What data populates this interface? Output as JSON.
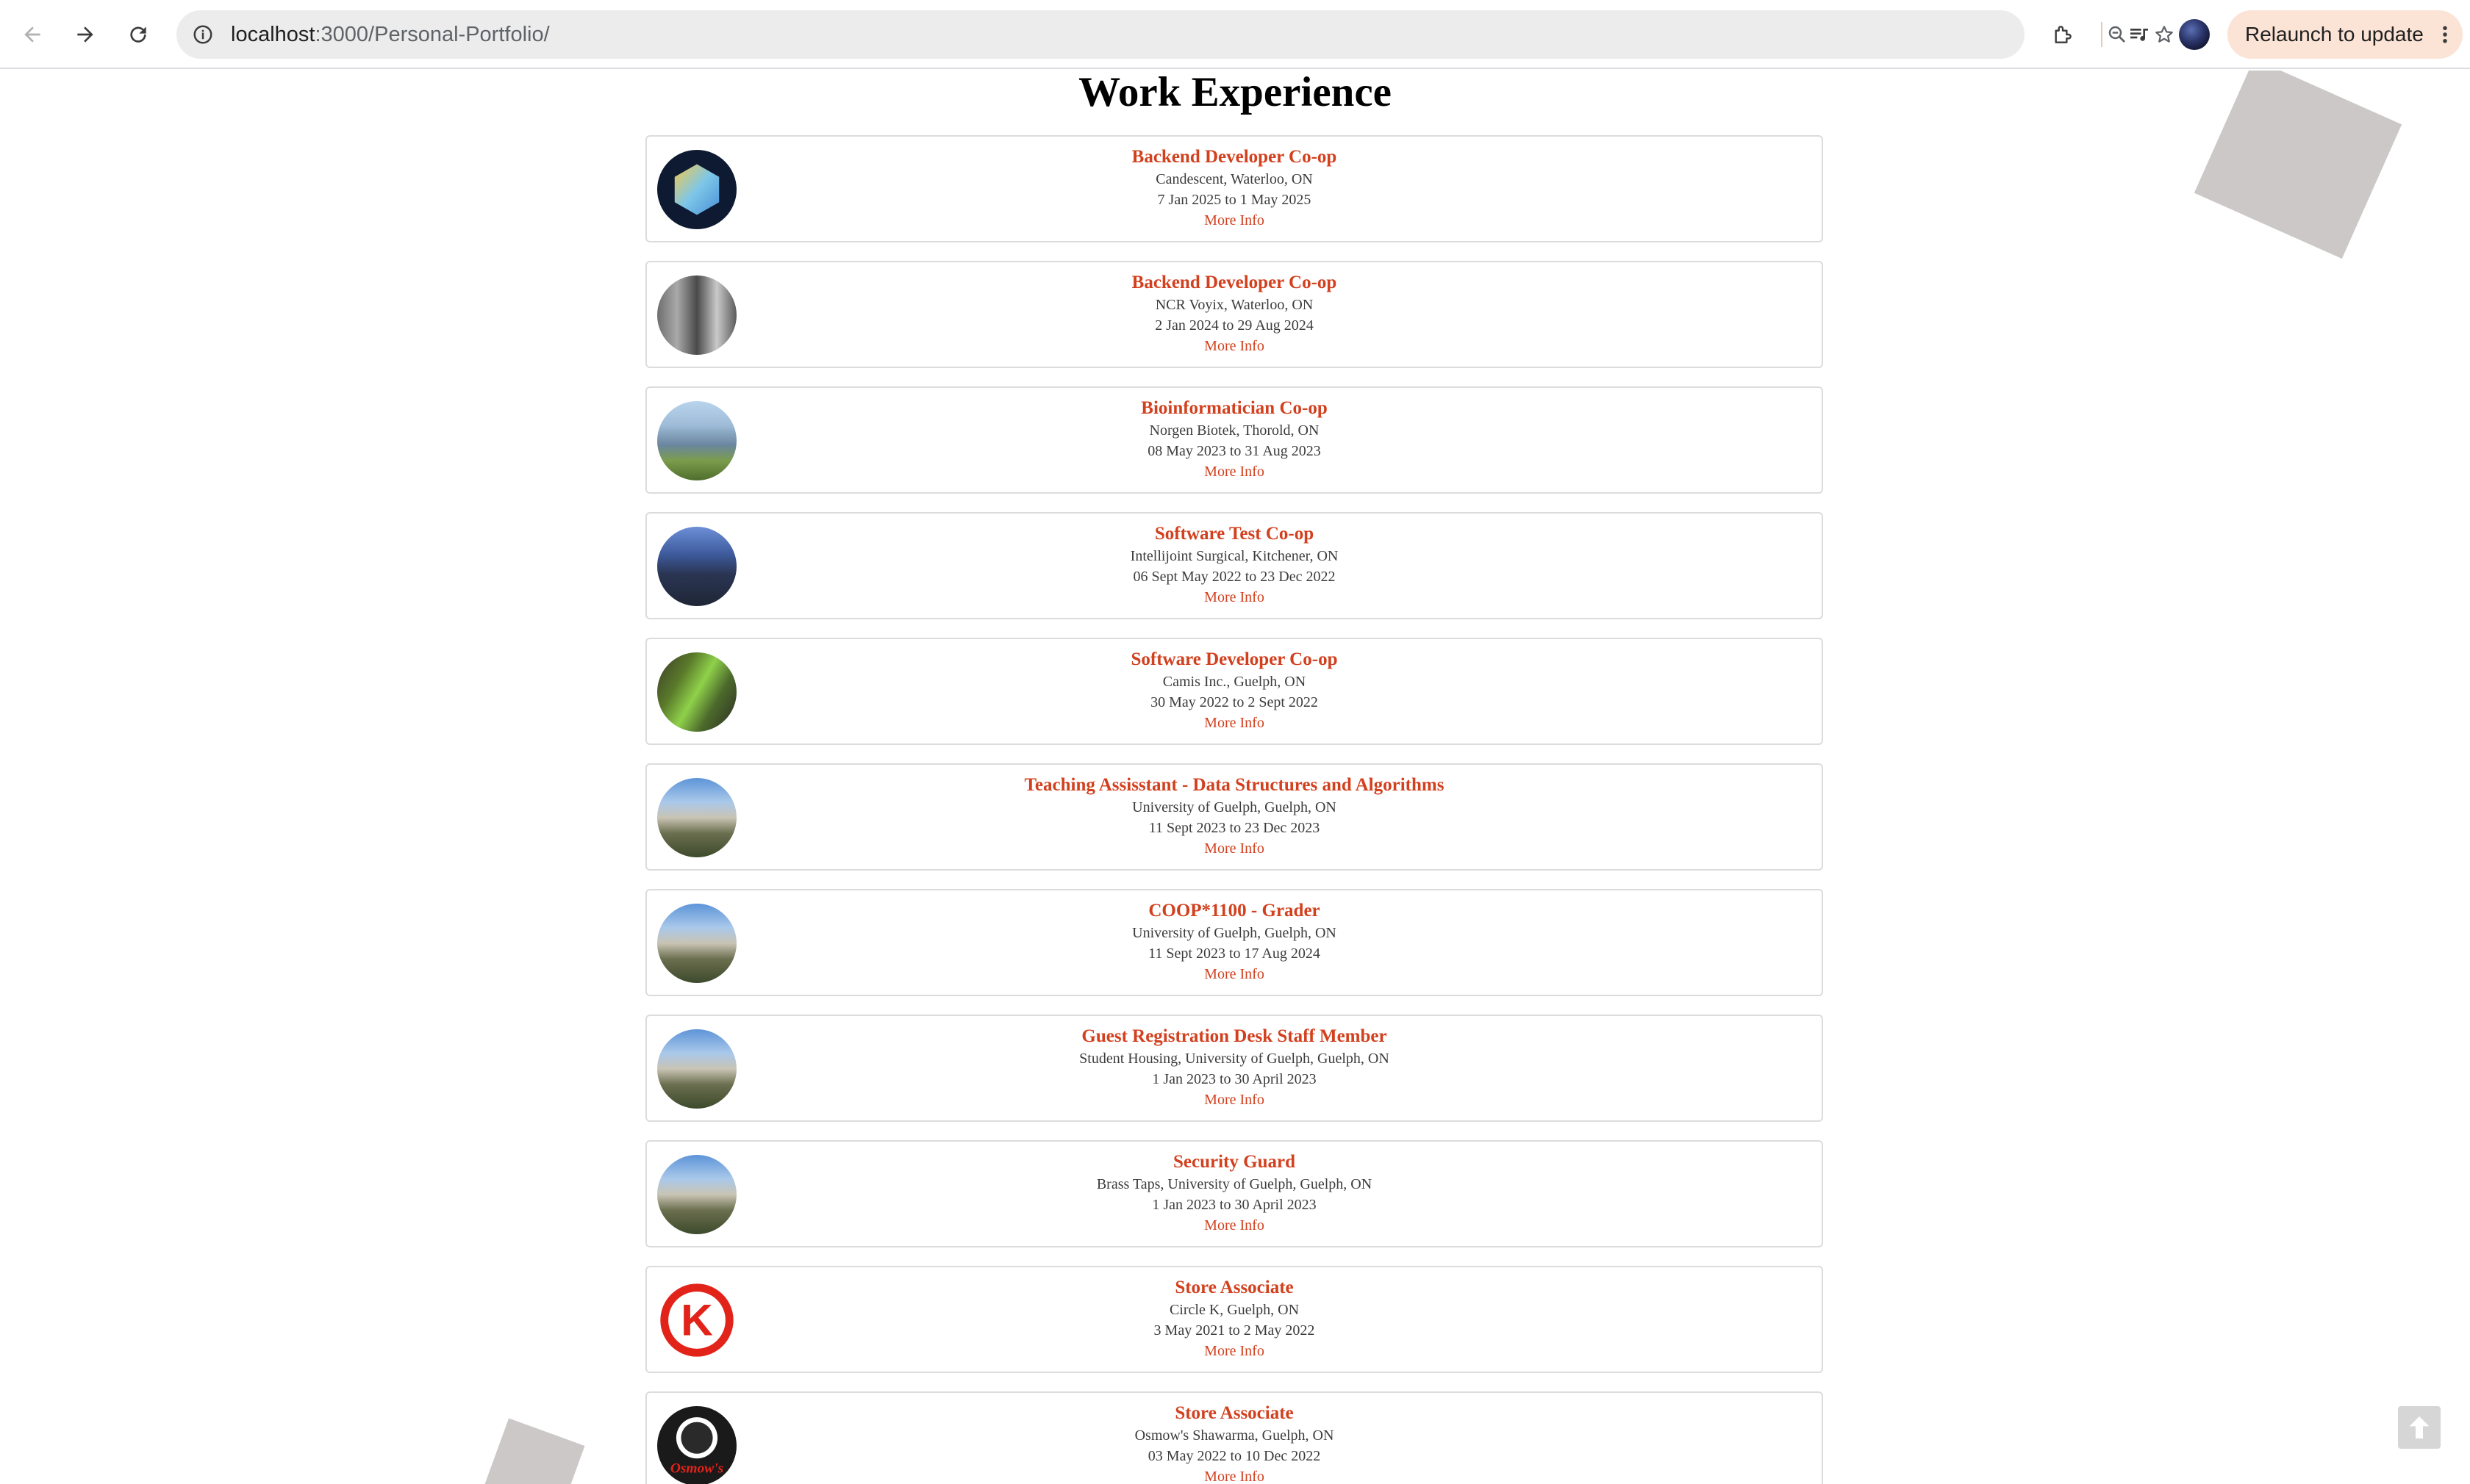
{
  "browser": {
    "url_host": "localhost",
    "url_rest": ":3000/Personal-Portfolio/",
    "relaunch_label": "Relaunch to update",
    "icons": [
      "back-icon",
      "forward-icon",
      "reload-icon",
      "info-icon",
      "zoom-icon",
      "star-icon",
      "extensions-icon",
      "media-controls-icon",
      "profile-avatar",
      "more-vert-icon"
    ]
  },
  "page": {
    "title": "Work Experience",
    "accent_color": "#d2401e",
    "jobs": [
      {
        "title": "Backend Developer Co-op",
        "company": "Candescent, Waterloo, ON",
        "dates": "7 Jan 2025 to 1 May 2025",
        "link": "More Info"
      },
      {
        "title": "Backend Developer Co-op",
        "company": "NCR Voyix, Waterloo, ON",
        "dates": "2 Jan 2024 to 29 Aug 2024",
        "link": "More Info"
      },
      {
        "title": "Bioinformatician Co-op",
        "company": "Norgen Biotek, Thorold, ON",
        "dates": "08 May 2023 to 31 Aug 2023",
        "link": "More Info"
      },
      {
        "title": "Software Test Co-op",
        "company": "Intellijoint Surgical, Kitchener, ON",
        "dates": "06 Sept May 2022 to 23 Dec 2022",
        "link": "More Info"
      },
      {
        "title": "Software Developer Co-op",
        "company": "Camis Inc., Guelph, ON",
        "dates": "30 May 2022 to 2 Sept 2022",
        "link": "More Info"
      },
      {
        "title": "Teaching Assisstant - Data Structures and Algorithms",
        "company": "University of Guelph, Guelph, ON",
        "dates": "11 Sept 2023 to 23 Dec 2023",
        "link": "More Info"
      },
      {
        "title": "COOP*1100 - Grader",
        "company": "University of Guelph, Guelph, ON",
        "dates": "11 Sept 2023 to 17 Aug 2024",
        "link": "More Info"
      },
      {
        "title": "Guest Registration Desk Staff Member",
        "company": "Student Housing, University of Guelph, Guelph, ON",
        "dates": "1 Jan 2023 to 30 April 2023",
        "link": "More Info"
      },
      {
        "title": "Security Guard",
        "company": "Brass Taps, University of Guelph, Guelph, ON",
        "dates": "1 Jan 2023 to 30 April 2023",
        "link": "More Info"
      },
      {
        "title": "Store Associate",
        "company": "Circle K, Guelph, ON",
        "dates": "3 May 2021 to 2 May 2022",
        "link": "More Info"
      },
      {
        "title": "Store Associate",
        "company": "Osmow's Shawarma, Guelph, ON",
        "dates": "03 May 2022 to 10 Dec 2022",
        "link": "More Info"
      }
    ],
    "logo_circlek_text": "K",
    "logo_osmows_text": "Osmow's"
  }
}
